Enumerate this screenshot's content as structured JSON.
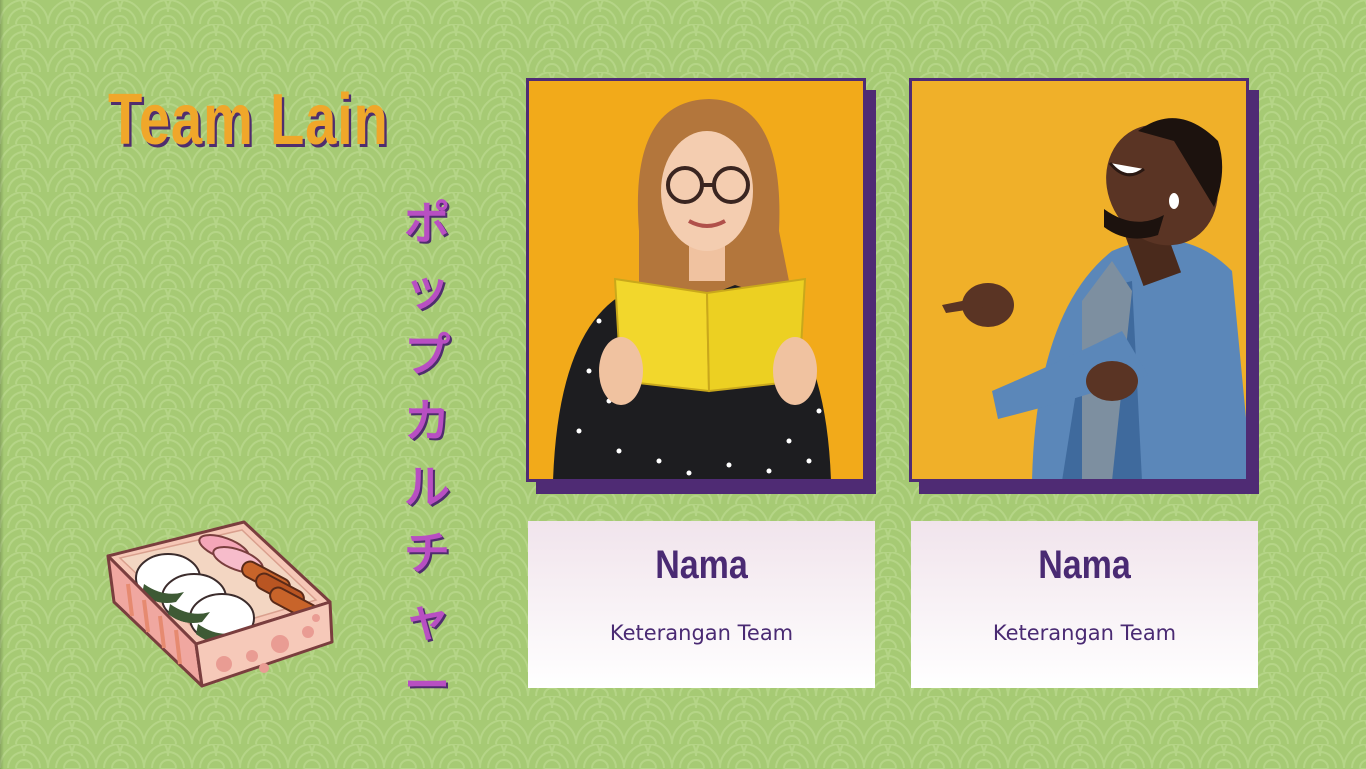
{
  "slide": {
    "title": "Team Lain",
    "vertical_text": [
      "ポ",
      "ッ",
      "プ",
      "カ",
      "ル",
      "チ",
      "ャ",
      "ー"
    ],
    "colors": {
      "background": "#a6ca74",
      "title": "#f0a72a",
      "accent_purple": "#4f2b74",
      "japanese_text": "#b84fc2",
      "photo_background": "#f2aa1a"
    }
  },
  "team": [
    {
      "name": "Nama",
      "description": "Keterangan Team",
      "photo_icon": "woman-reading-book-photo"
    },
    {
      "name": "Nama",
      "description": "Keterangan Team",
      "photo_icon": "man-laughing-photo"
    }
  ],
  "decoration": {
    "icon": "bento-box-icon"
  }
}
